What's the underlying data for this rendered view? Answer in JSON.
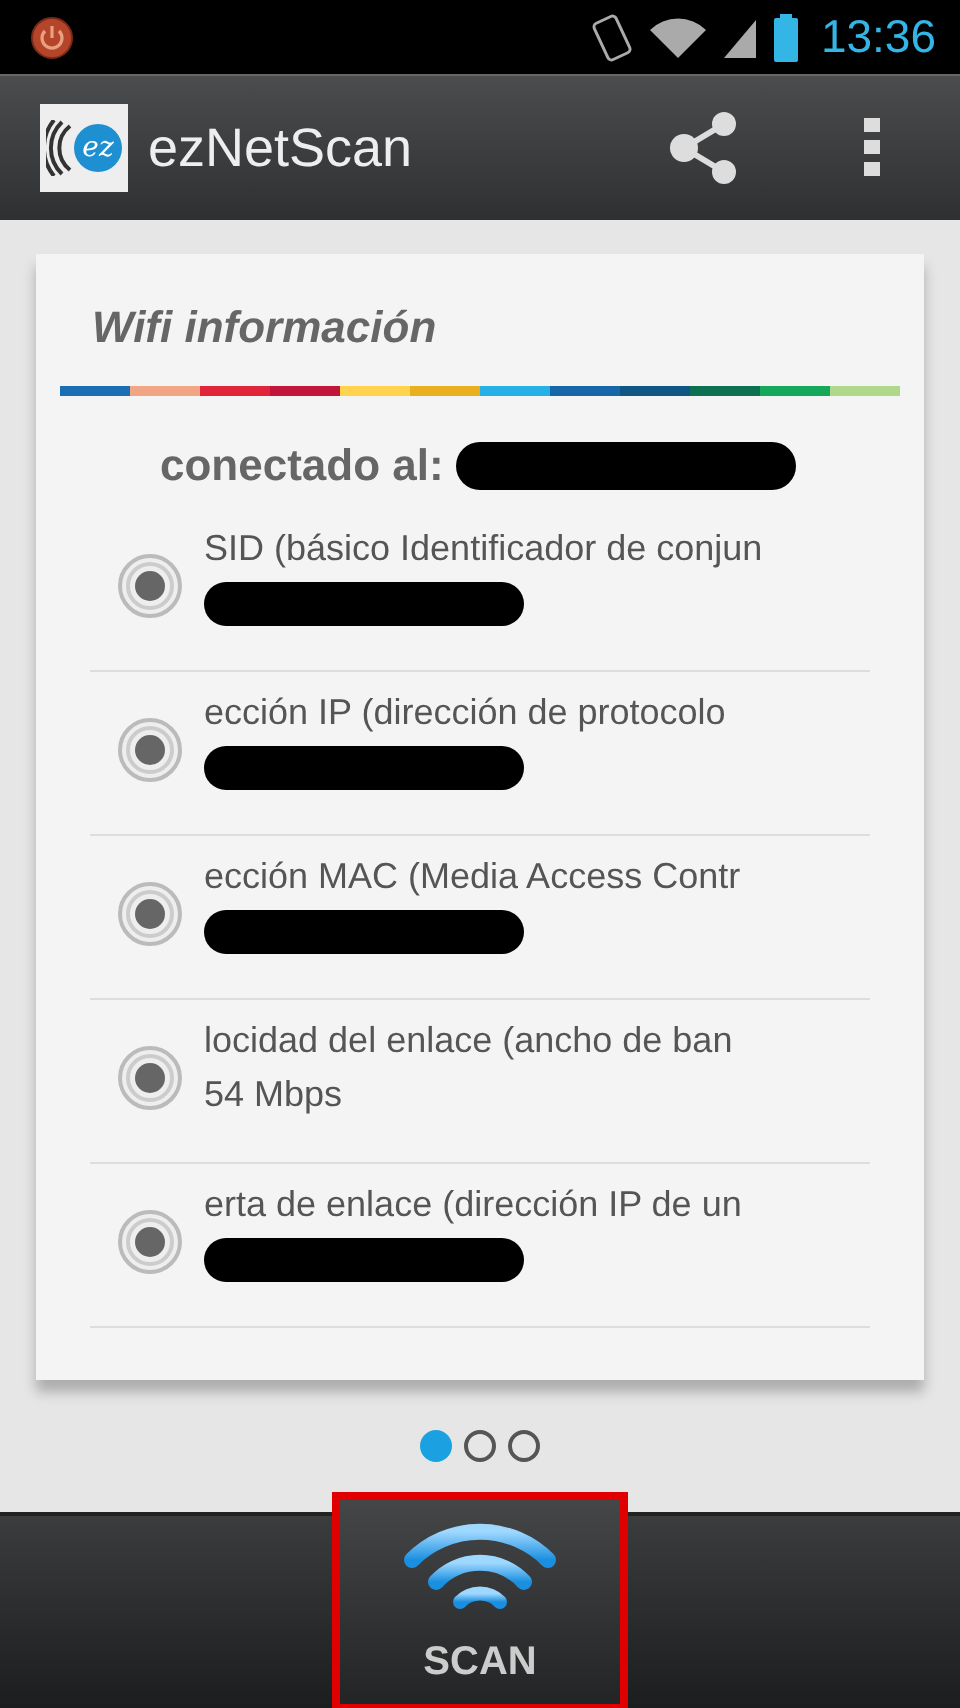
{
  "status_bar": {
    "time": "13:36"
  },
  "app_bar": {
    "title": "ezNetScan",
    "logo_text": "ez"
  },
  "card": {
    "title": "Wifi información",
    "connected_label": "conectado al:",
    "connected_redacted": true,
    "items": [
      {
        "label": "SID (básico Identificador de conjun",
        "redacted": true
      },
      {
        "label": "ección IP (dirección de protocolo",
        "redacted": true
      },
      {
        "label": "ección MAC (Media Access Contr",
        "redacted": true
      },
      {
        "label": "locidad del enlace (ancho de ban",
        "value": "54 Mbps"
      },
      {
        "label": "erta de enlace (dirección IP de un",
        "redacted": true
      }
    ]
  },
  "pager": [
    {
      "selected": true
    },
    {
      "selected": false
    },
    {
      "selected": false
    }
  ],
  "scan_button": {
    "label": "SCAN",
    "highlighted": true
  }
}
